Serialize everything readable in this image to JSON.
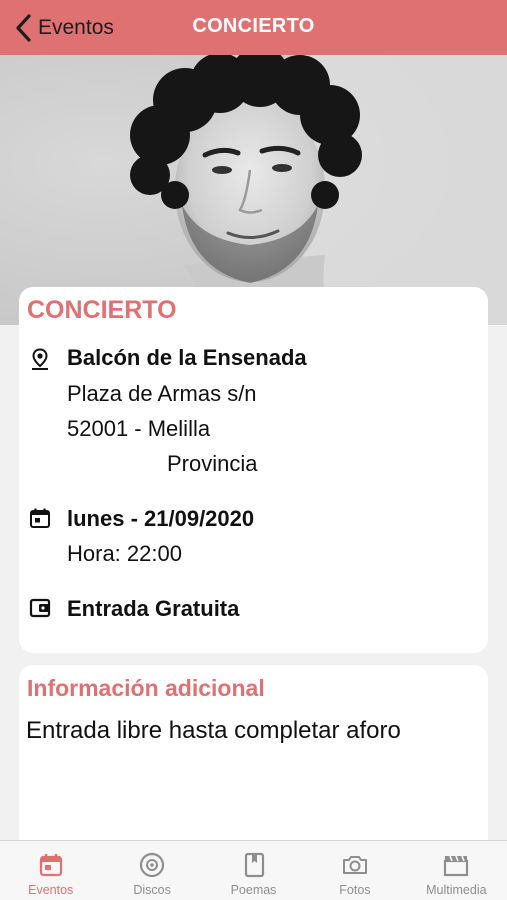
{
  "navbar": {
    "back_label": "Eventos",
    "title": "CONCIERTO"
  },
  "hero": {
    "image": "artist-portrait-photo"
  },
  "event": {
    "heading": "CONCIERTO",
    "venue_name": "Balcón de la Ensenada",
    "address_line": "Plaza de Armas s/n",
    "postal_city": "52001   - Melilla",
    "province": "Provincia",
    "date": "lunes - 21/09/2020",
    "time": "Hora: 22:00",
    "entry": "Entrada Gratuita",
    "icons": {
      "location": "location-pin-icon",
      "date": "calendar-icon",
      "entry": "wallet-icon"
    }
  },
  "info": {
    "heading": "Información adicional",
    "text": "Entrada libre hasta completar aforo"
  },
  "tabs": [
    {
      "label": "Eventos",
      "icon": "calendar-icon",
      "active": true
    },
    {
      "label": "Discos",
      "icon": "disc-icon",
      "active": false
    },
    {
      "label": "Poemas",
      "icon": "book-icon",
      "active": false
    },
    {
      "label": "Fotos",
      "icon": "camera-icon",
      "active": false
    },
    {
      "label": "Multimedia",
      "icon": "film-icon",
      "active": false
    }
  ],
  "colors": {
    "accent": "#e07173",
    "text": "#111111",
    "tab_inactive": "#8e8e8e",
    "background": "#f1f1f1"
  }
}
